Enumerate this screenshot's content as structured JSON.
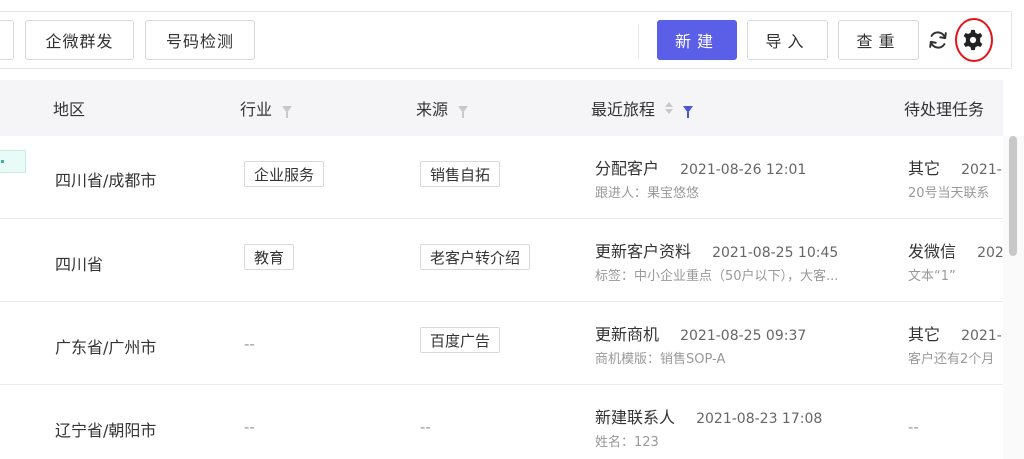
{
  "toolbar": {
    "group_send_label": "企微群发",
    "number_check_label": "号码检测",
    "new_label": "新建",
    "import_label": "导入",
    "dedupe_label": "查重",
    "refresh_icon": "refresh-icon",
    "settings_icon": "gear-icon",
    "primary_color": "#5b5ee6",
    "highlight_color": "#e3151a"
  },
  "table": {
    "columns": [
      {
        "label": "地区"
      },
      {
        "label": "行业",
        "filter": true
      },
      {
        "label": "来源",
        "filter": true
      },
      {
        "label": "最近旅程",
        "sort": true,
        "filter": true,
        "filter_active": true
      },
      {
        "label": "待处理任务"
      }
    ],
    "rows": [
      {
        "region": "四川省/成都市",
        "industry": "企业服务",
        "source": "销售自拓",
        "journey_title": "分配客户",
        "journey_time": "2021-08-26 12:01",
        "journey_sub": "跟进人：果宝悠悠",
        "task_title": "其它",
        "task_time": "2021-",
        "task_sub": "20号当天联系"
      },
      {
        "region": "四川省",
        "industry": "教育",
        "source": "老客户转介绍",
        "journey_title": "更新客户资料",
        "journey_time": "2021-08-25 10:45",
        "journey_sub": "标签：中小企业重点（50户以下），大客...",
        "task_title": "发微信",
        "task_time": "202",
        "task_sub": "文本“1”"
      },
      {
        "region": "广东省/广州市",
        "industry": "--",
        "source": "百度广告",
        "journey_title": "更新商机",
        "journey_time": "2021-08-25 09:37",
        "journey_sub": "商机模版：销售SOP-A",
        "task_title": "其它",
        "task_time": "2021-",
        "task_sub": "客户还有2个月"
      },
      {
        "region": "辽宁省/朝阳市",
        "industry": "--",
        "source": "--",
        "journey_title": "新建联系人",
        "journey_time": "2021-08-23 17:08",
        "journey_sub": "姓名：123",
        "task_title": "--"
      }
    ]
  }
}
